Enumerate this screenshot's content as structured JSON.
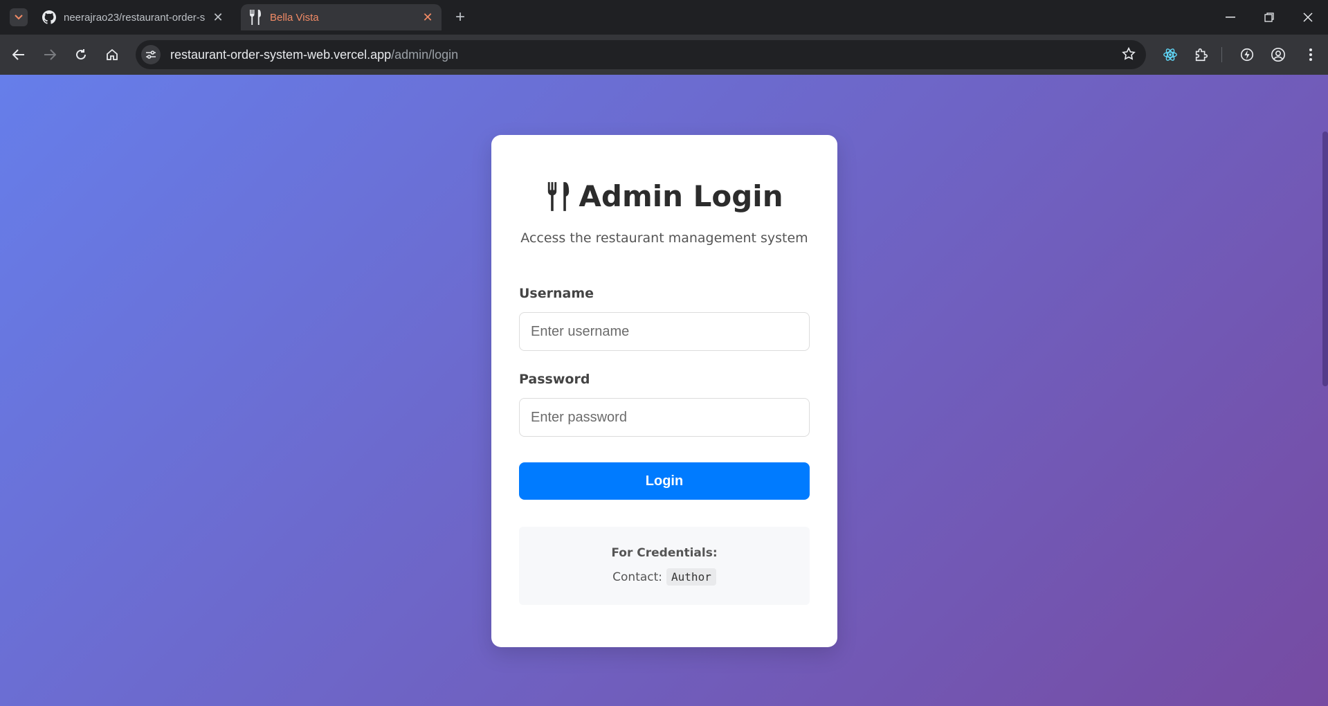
{
  "browser": {
    "tabs": [
      {
        "title": "neerajrao23/restaurant-order-s",
        "favicon": "github-icon",
        "active": false
      },
      {
        "title": "Bella Vista",
        "favicon": "fork-knife-icon",
        "active": true
      }
    ],
    "url_host": "restaurant-order-system-web.vercel.app",
    "url_path": "/admin/login"
  },
  "login": {
    "icon": "fork-knife-icon",
    "title": "Admin Login",
    "subtitle": "Access the restaurant management system",
    "username_label": "Username",
    "username_placeholder": "Enter username",
    "password_label": "Password",
    "password_placeholder": "Enter password",
    "submit_label": "Login",
    "credentials_title": "For Credentials:",
    "contact_label": "Contact:",
    "contact_value": "Author"
  },
  "colors": {
    "gradient_start": "#667eea",
    "gradient_end": "#764ba2",
    "button": "#007bff",
    "active_tab_text": "#f28b66"
  }
}
